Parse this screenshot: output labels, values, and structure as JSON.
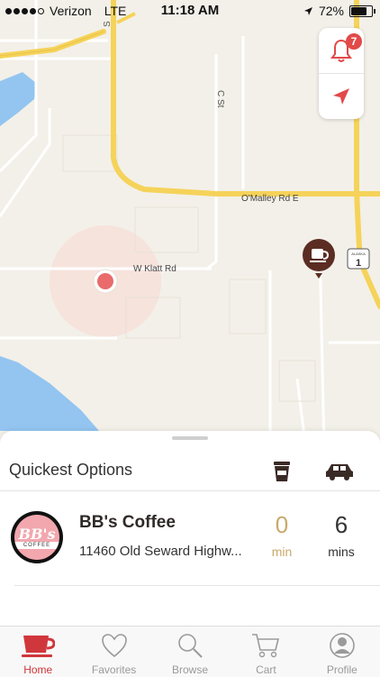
{
  "status_bar": {
    "carrier": "Verizon",
    "network": "LTE",
    "time": "11:18 AM",
    "battery_text": "72%",
    "battery_level": 0.72,
    "signal_bars": 4
  },
  "map": {
    "street_labels": [
      "S",
      "C St",
      "O'Malley Rd E",
      "W Klatt Rd"
    ],
    "highway_shield": "1",
    "highway_shield_state": "ALASKA"
  },
  "map_controls": {
    "notifications_count": "7"
  },
  "sheet": {
    "title": "Quickest Options"
  },
  "shop": {
    "logo_text": "BB's",
    "logo_band": "COFFEE",
    "name": "BB's Coffee",
    "address": "11460 Old Seward Highw...",
    "walk_time": "0",
    "walk_unit": "min",
    "drive_time": "6",
    "drive_unit": "mins"
  },
  "tabs": [
    {
      "label": "Home",
      "icon": "coffee-cup-icon",
      "active": true
    },
    {
      "label": "Favorites",
      "icon": "heart-icon",
      "active": false
    },
    {
      "label": "Browse",
      "icon": "magnifier-icon",
      "active": false
    },
    {
      "label": "Cart",
      "icon": "cart-icon",
      "active": false
    },
    {
      "label": "Profile",
      "icon": "person-icon",
      "active": false
    }
  ],
  "colors": {
    "accent": "#d0373c",
    "brand_brown": "#5b2d22",
    "walk_time": "#c9a96b",
    "road_highway": "#f5d35a"
  }
}
